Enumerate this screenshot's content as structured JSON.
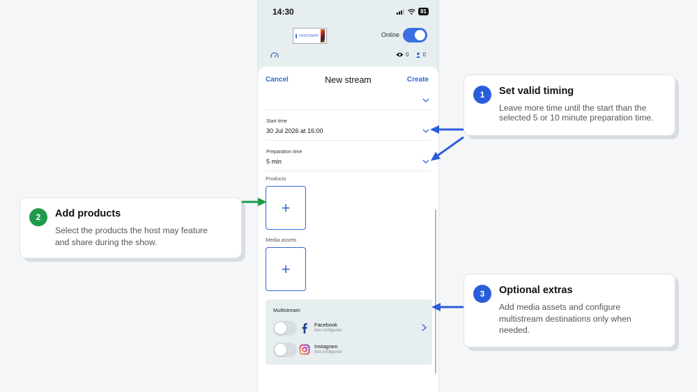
{
  "status_bar": {
    "time": "14:30",
    "battery": "81"
  },
  "header": {
    "logo_text": "HOSTFAIRY",
    "online_label": "Online",
    "views_count": "0",
    "viewers_count": "0"
  },
  "sheet": {
    "cancel_label": "Cancel",
    "title": "New stream",
    "create_label": "Create",
    "start_time": {
      "label": "Start time",
      "value": "30 Jul 2026 at 16:00"
    },
    "preparation_time": {
      "label": "Preparation time",
      "value": "5 min"
    },
    "products_label": "Products",
    "media_assets_label": "Media assets",
    "add_symbol": "+",
    "multistream": {
      "title": "Multistream",
      "items": [
        {
          "name": "Facebook",
          "status": "Not configured",
          "icon": "facebook-icon"
        },
        {
          "name": "Instagram",
          "status": "Not configured",
          "icon": "instagram-icon"
        }
      ]
    }
  },
  "callouts": [
    {
      "number": "1",
      "title": "Set valid timing",
      "body_line1": "Leave more time until the start than the",
      "body_line2": "selected 5 or 10 minute preparation time."
    },
    {
      "number": "2",
      "title": "Add products",
      "body_line1": "Select the products the host may feature",
      "body_line2": "and share during the show."
    },
    {
      "number": "3",
      "title": "Optional extras",
      "body_line1": "Add media assets and configure",
      "body_line2": "multistream destinations only when",
      "body_line3": "needed."
    }
  ],
  "colors": {
    "accent": "#3566d6",
    "callout_blue": "#2a5ddb",
    "callout_green": "#1f9a4a",
    "phone_bg": "#e6eef0"
  }
}
